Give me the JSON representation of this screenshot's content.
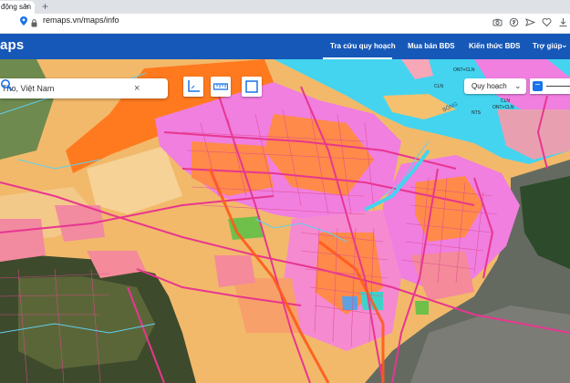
{
  "browser": {
    "tab_title": "động sản",
    "tab_close": "×",
    "new_tab": "+",
    "url": "remaps.vn/maps/info",
    "nav": {
      "back": "←",
      "forward": "→",
      "reload": "↻"
    }
  },
  "header": {
    "brand": "aps",
    "nav_items": [
      {
        "label": "Tra cứu quy hoạch"
      },
      {
        "label": "Mua bán BĐS"
      },
      {
        "label": "Kiến thức BĐS"
      },
      {
        "label": "Trợ giúp"
      }
    ],
    "help_chevron": "⌄"
  },
  "search": {
    "value": "Tho, Việt Nam",
    "clear": "×"
  },
  "layer_select": {
    "label": "Quy hoạch",
    "chevron": "⌄"
  },
  "opacity": {
    "minus": "−"
  },
  "map_labels": [
    {
      "text": "CLN"
    },
    {
      "text": "ONT+CLN"
    },
    {
      "text": "CLN"
    },
    {
      "text": "NTS"
    },
    {
      "text": "ONT+CLN"
    },
    {
      "text": "SÔNG"
    }
  ],
  "colors": {
    "header": "#1658b8",
    "river": "#44d4f0",
    "residential": "#f07fe0",
    "farmland": "#f2b96b",
    "urban_core": "#ff7a3d",
    "roads": "#e8368f",
    "satellite": "#3f4a30"
  }
}
